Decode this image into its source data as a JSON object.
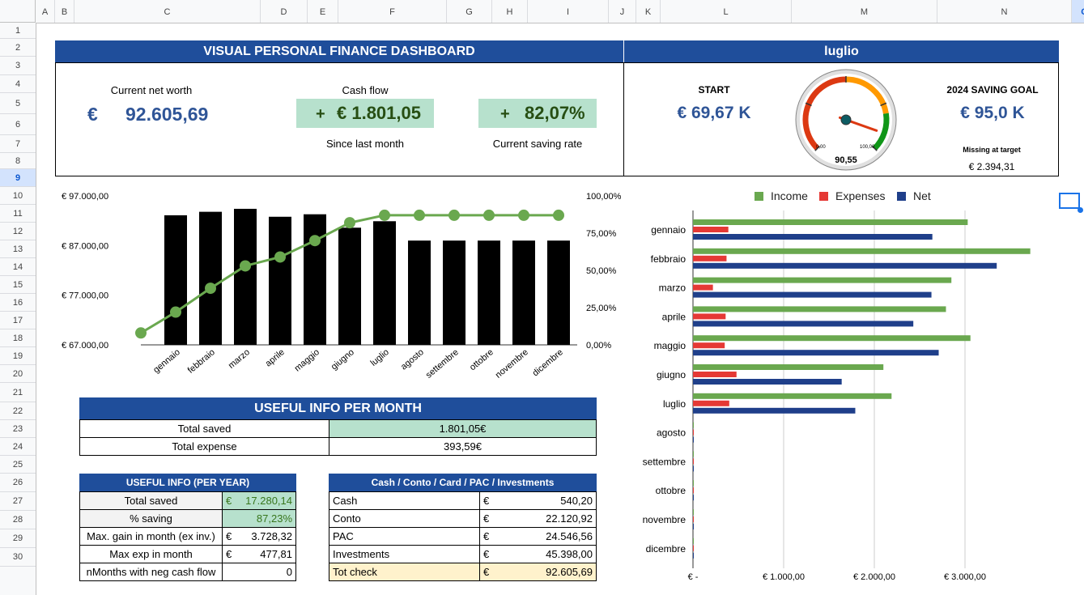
{
  "columns": [
    {
      "id": "A",
      "w": 24
    },
    {
      "id": "B",
      "w": 24
    },
    {
      "id": "C",
      "w": 230
    },
    {
      "id": "D",
      "w": 58
    },
    {
      "id": "E",
      "w": 38
    },
    {
      "id": "F",
      "w": 134
    },
    {
      "id": "G",
      "w": 56
    },
    {
      "id": "H",
      "w": 44
    },
    {
      "id": "I",
      "w": 100
    },
    {
      "id": "J",
      "w": 34
    },
    {
      "id": "K",
      "w": 30
    },
    {
      "id": "L",
      "w": 162
    },
    {
      "id": "M",
      "w": 180
    },
    {
      "id": "N",
      "w": 166
    },
    {
      "id": "O",
      "w": 32
    }
  ],
  "selected_column": "O",
  "rows": [
    "1",
    "2",
    "3",
    "4",
    "5",
    "6",
    "7",
    "8",
    "9",
    "10",
    "11",
    "12",
    "13",
    "14",
    "15",
    "16",
    "17",
    "18",
    "19",
    "20",
    "21",
    "22",
    "23",
    "24",
    "25",
    "26",
    "27",
    "28",
    "29",
    "30"
  ],
  "selected_row": "9",
  "dashboard": {
    "title": "VISUAL PERSONAL FINANCE DASHBOARD",
    "month": "luglio",
    "net_worth_label": "Current net worth",
    "net_worth_currency": "€",
    "net_worth_value": "92.605,69",
    "cash_flow_label": "Cash flow",
    "cash_flow_sign": "+",
    "cash_flow_value": "€ 1.801,05",
    "cash_flow_sub": "Since last month",
    "saving_rate_sign": "+",
    "saving_rate_value": "82,07%",
    "saving_rate_sub": "Current saving rate",
    "start_label": "START",
    "start_value": "€ 69,67 K",
    "goal_label": "2024 SAVING GOAL",
    "goal_value": "€ 95,0 K",
    "missing_label": "Missing at target",
    "missing_value": "€ 2.394,31",
    "gauge": {
      "value": 90.55,
      "display": "90,55",
      "min_label": "0,00",
      "max_label": "100,00"
    }
  },
  "chart_left": {
    "type": "bar",
    "categories": [
      "gennaio",
      "febbraio",
      "marzo",
      "aprile",
      "maggio",
      "giugno",
      "luglio",
      "agosto",
      "settembre",
      "ottobre",
      "novembre",
      "dicembre"
    ],
    "bar_values": [
      93100,
      93800,
      94400,
      92800,
      93300,
      90600,
      91900,
      88000,
      88000,
      88000,
      88000,
      88000
    ],
    "line_values_pct": [
      8,
      22,
      38,
      53,
      59,
      70,
      82,
      87,
      87,
      87,
      87,
      87,
      87
    ],
    "y_left_ticks": [
      "€ 97.000,00",
      "€ 87.000,00",
      "€ 77.000,00",
      "€ 67.000,00"
    ],
    "y_left_range": [
      67000,
      97000
    ],
    "y_right_ticks": [
      "100,00%",
      "75,00%",
      "50,00%",
      "25,00%",
      "0,00%"
    ],
    "y_right_range": [
      0,
      100
    ],
    "bar_color": "#000000",
    "line_color": "#6aa84f"
  },
  "chart_right": {
    "type": "bar",
    "categories": [
      "gennaio",
      "febbraio",
      "marzo",
      "aprile",
      "maggio",
      "giugno",
      "luglio",
      "agosto",
      "settembre",
      "ottobre",
      "novembre",
      "dicembre"
    ],
    "series": [
      {
        "name": "Income",
        "color": "#6aa84f",
        "values": [
          3030,
          3720,
          2850,
          2790,
          3060,
          2100,
          2190,
          0,
          0,
          0,
          0,
          0
        ]
      },
      {
        "name": "Expenses",
        "color": "#e53935",
        "values": [
          390,
          370,
          220,
          360,
          350,
          480,
          400,
          0,
          0,
          0,
          0,
          0
        ]
      },
      {
        "name": "Net",
        "color": "#1f3f8a",
        "values": [
          2640,
          3350,
          2630,
          2430,
          2710,
          1640,
          1790,
          0,
          0,
          0,
          0,
          0
        ]
      }
    ],
    "x_ticks": [
      "€ -",
      "€ 1.000,00",
      "€ 2.000,00",
      "€ 3.000,00"
    ],
    "x_range": [
      0,
      4000
    ]
  },
  "monthly": {
    "title": "USEFUL INFO PER MONTH",
    "rows": [
      {
        "label": "Total saved",
        "value": "1.801,05€"
      },
      {
        "label": "Total expense",
        "value": "393,59€"
      }
    ]
  },
  "yearly": {
    "title": "USEFUL INFO (PER YEAR)",
    "rows": [
      {
        "label": "Total saved",
        "cur": "€",
        "value": "17.280,14"
      },
      {
        "label": "% saving",
        "cur": "",
        "value": "87,23%"
      },
      {
        "label": "Max. gain in month (ex inv.)",
        "cur": "€",
        "value": "3.728,32"
      },
      {
        "label": "Max exp in month",
        "cur": "€",
        "value": "477,81"
      },
      {
        "label": "nMonths with neg cash flow",
        "cur": "",
        "value": "0"
      }
    ]
  },
  "accounts": {
    "title": "Cash / Conto / Card / PAC / Investments",
    "rows": [
      {
        "label": "Cash",
        "cur": "€",
        "value": "540,20"
      },
      {
        "label": "Conto",
        "cur": "€",
        "value": "22.120,92"
      },
      {
        "label": "PAC",
        "cur": "€",
        "value": "24.546,56"
      },
      {
        "label": "Investments",
        "cur": "€",
        "value": "45.398,00"
      },
      {
        "label": "Tot check",
        "cur": "€",
        "value": "92.605,69"
      }
    ]
  }
}
